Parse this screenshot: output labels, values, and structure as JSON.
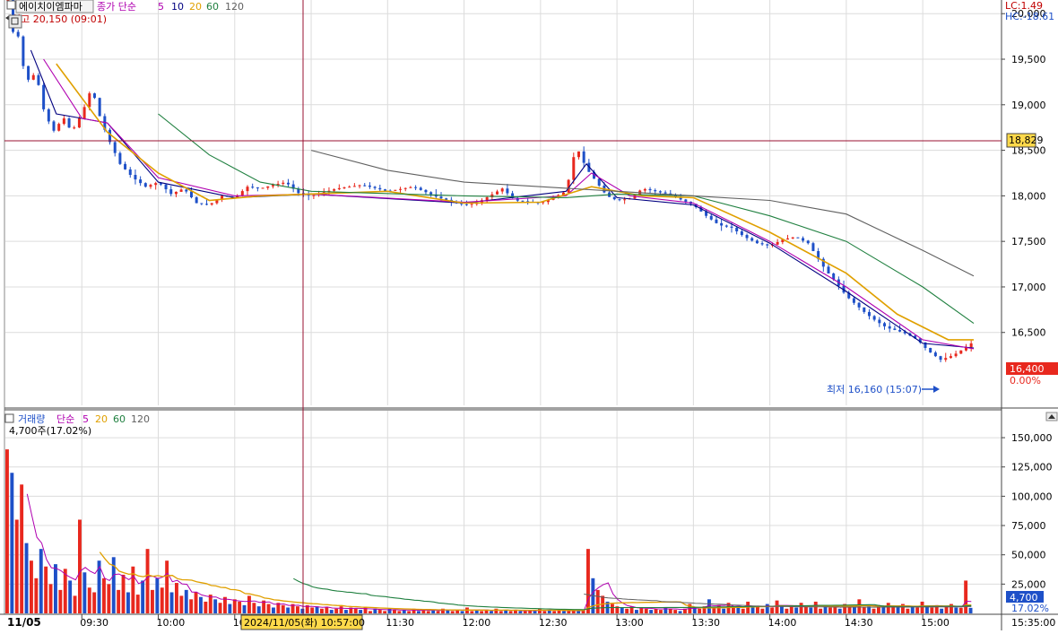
{
  "price_header": {
    "stock_name": "에이치이엠파마",
    "ma_label": "종가 단순",
    "ma_periods": [
      "5",
      "10",
      "20",
      "60",
      "120"
    ],
    "high_label": "최고 20,150 (09:01)",
    "lc": "LC:1.49",
    "hc": "HC:-18.61"
  },
  "volume_header": {
    "label": "거래량",
    "ma_label": "단순",
    "ma_periods": [
      "5",
      "20",
      "60",
      "120"
    ],
    "current": "4,700주(17.02%)"
  },
  "crosshair": {
    "price_value": "18,829",
    "time_label": "2024/11/05(화) 10:57:00"
  },
  "current_price": {
    "value": "16,400",
    "change": "0.00%"
  },
  "current_volume": {
    "value": "4,700",
    "pct": "17.02%"
  },
  "low_label": "최저 16,160 (15:07)",
  "date_label": "11/05",
  "end_time_label": "15:35:00",
  "colors": {
    "up": "#e8281e",
    "down": "#1e50c8",
    "ma5": "#000080",
    "ma10": "#b000b0",
    "ma20": "#e0a000",
    "ma60": "#208040",
    "ma120": "#606060",
    "grid": "#dcdcdc",
    "axis": "#444444",
    "crosshair": "#9a1030"
  },
  "chart_data": {
    "type": "candlestick",
    "session": "2024-11-05",
    "price_axis": {
      "ylim": [
        15700,
        20150
      ],
      "ticks": [
        16500,
        17000,
        17500,
        18000,
        18500,
        19000,
        19500,
        20000
      ]
    },
    "volume_axis": {
      "ylim": [
        0,
        160000
      ],
      "ticks": [
        25000,
        50000,
        75000,
        100000,
        125000,
        150000
      ]
    },
    "time_ticks": [
      "09:30",
      "10:00",
      "10:30",
      "11:00",
      "11:30",
      "12:00",
      "12:30",
      "13:00",
      "13:30",
      "14:00",
      "14:30",
      "15:00"
    ],
    "price_points": [
      [
        "09:01",
        20150
      ],
      [
        "09:02",
        19700
      ],
      [
        "09:04",
        19900
      ],
      [
        "09:06",
        19600
      ],
      [
        "09:08",
        19250
      ],
      [
        "09:12",
        19350
      ],
      [
        "09:15",
        18950
      ],
      [
        "09:18",
        18750
      ],
      [
        "09:20",
        18680
      ],
      [
        "09:22",
        18900
      ],
      [
        "09:26",
        18700
      ],
      [
        "09:30",
        18900
      ],
      [
        "09:34",
        19200
      ],
      [
        "09:36",
        18950
      ],
      [
        "09:40",
        18650
      ],
      [
        "09:45",
        18350
      ],
      [
        "09:50",
        18200
      ],
      [
        "09:55",
        18100
      ],
      [
        "10:00",
        18150
      ],
      [
        "10:05",
        18020
      ],
      [
        "10:10",
        18080
      ],
      [
        "10:15",
        17920
      ],
      [
        "10:20",
        17900
      ],
      [
        "10:25",
        18000
      ],
      [
        "10:30",
        17980
      ],
      [
        "10:35",
        18100
      ],
      [
        "10:40",
        18080
      ],
      [
        "10:45",
        18120
      ],
      [
        "10:50",
        18150
      ],
      [
        "10:55",
        18030
      ],
      [
        "11:00",
        18000
      ],
      [
        "11:10",
        18080
      ],
      [
        "11:20",
        18120
      ],
      [
        "11:30",
        18050
      ],
      [
        "11:40",
        18100
      ],
      [
        "11:50",
        17980
      ],
      [
        "12:00",
        17900
      ],
      [
        "12:05",
        17920
      ],
      [
        "12:10",
        18000
      ],
      [
        "12:15",
        18080
      ],
      [
        "12:20",
        17950
      ],
      [
        "12:30",
        17920
      ],
      [
        "12:35",
        17980
      ],
      [
        "12:40",
        18050
      ],
      [
        "12:44",
        18550
      ],
      [
        "12:48",
        18300
      ],
      [
        "12:52",
        18150
      ],
      [
        "12:56",
        18000
      ],
      [
        "13:00",
        17950
      ],
      [
        "13:05",
        17970
      ],
      [
        "13:10",
        18080
      ],
      [
        "13:20",
        18020
      ],
      [
        "13:30",
        17900
      ],
      [
        "13:35",
        17780
      ],
      [
        "13:40",
        17680
      ],
      [
        "13:45",
        17650
      ],
      [
        "13:50",
        17550
      ],
      [
        "13:55",
        17480
      ],
      [
        "14:00",
        17450
      ],
      [
        "14:05",
        17520
      ],
      [
        "14:10",
        17550
      ],
      [
        "14:15",
        17480
      ],
      [
        "14:18",
        17350
      ],
      [
        "14:22",
        17180
      ],
      [
        "14:26",
        17050
      ],
      [
        "14:30",
        16900
      ],
      [
        "14:34",
        16800
      ],
      [
        "14:38",
        16700
      ],
      [
        "14:42",
        16620
      ],
      [
        "14:46",
        16550
      ],
      [
        "14:50",
        16520
      ],
      [
        "14:54",
        16480
      ],
      [
        "14:58",
        16420
      ],
      [
        "15:02",
        16300
      ],
      [
        "15:07",
        16200
      ],
      [
        "15:12",
        16250
      ],
      [
        "15:16",
        16320
      ],
      [
        "15:20",
        16400
      ]
    ],
    "moving_averages": [
      {
        "name": "5",
        "points": [
          [
            "09:10",
            19600
          ],
          [
            "09:20",
            18900
          ],
          [
            "09:30",
            18850
          ],
          [
            "09:40",
            18800
          ],
          [
            "10:00",
            18150
          ],
          [
            "10:30",
            17980
          ],
          [
            "11:00",
            18020
          ],
          [
            "12:00",
            17920
          ],
          [
            "12:40",
            18050
          ],
          [
            "12:48",
            18350
          ],
          [
            "13:00",
            17980
          ],
          [
            "13:30",
            17900
          ],
          [
            "14:00",
            17480
          ],
          [
            "14:30",
            16950
          ],
          [
            "15:00",
            16380
          ],
          [
            "15:20",
            16330
          ]
        ]
      },
      {
        "name": "10",
        "points": [
          [
            "09:15",
            19500
          ],
          [
            "09:30",
            18850
          ],
          [
            "09:40",
            18800
          ],
          [
            "10:00",
            18200
          ],
          [
            "10:30",
            18000
          ],
          [
            "11:00",
            18020
          ],
          [
            "12:00",
            17930
          ],
          [
            "12:40",
            18000
          ],
          [
            "12:50",
            18250
          ],
          [
            "13:05",
            18000
          ],
          [
            "13:30",
            17920
          ],
          [
            "14:00",
            17500
          ],
          [
            "14:30",
            17000
          ],
          [
            "15:00",
            16420
          ],
          [
            "15:20",
            16320
          ]
        ]
      },
      {
        "name": "20",
        "points": [
          [
            "09:20",
            19450
          ],
          [
            "09:40",
            18700
          ],
          [
            "10:00",
            18250
          ],
          [
            "10:20",
            17950
          ],
          [
            "10:40",
            18000
          ],
          [
            "11:30",
            18050
          ],
          [
            "12:00",
            17920
          ],
          [
            "12:30",
            17930
          ],
          [
            "12:50",
            18100
          ],
          [
            "13:10",
            18000
          ],
          [
            "13:30",
            17980
          ],
          [
            "14:00",
            17600
          ],
          [
            "14:30",
            17150
          ],
          [
            "14:50",
            16700
          ],
          [
            "15:10",
            16420
          ],
          [
            "15:20",
            16420
          ]
        ]
      },
      {
        "name": "60",
        "points": [
          [
            "10:00",
            18900
          ],
          [
            "10:20",
            18450
          ],
          [
            "10:40",
            18150
          ],
          [
            "11:00",
            18050
          ],
          [
            "12:00",
            18000
          ],
          [
            "12:40",
            17980
          ],
          [
            "13:00",
            18020
          ],
          [
            "13:30",
            18000
          ],
          [
            "14:00",
            17780
          ],
          [
            "14:30",
            17500
          ],
          [
            "15:00",
            17000
          ],
          [
            "15:20",
            16600
          ]
        ]
      },
      {
        "name": "120",
        "points": [
          [
            "11:00",
            18500
          ],
          [
            "11:30",
            18280
          ],
          [
            "12:00",
            18150
          ],
          [
            "13:00",
            18050
          ],
          [
            "13:30",
            18000
          ],
          [
            "14:00",
            17950
          ],
          [
            "14:30",
            17800
          ],
          [
            "15:00",
            17400
          ],
          [
            "15:20",
            17120
          ]
        ]
      }
    ],
    "volume_series": [
      [
        140000,
        120000,
        80000,
        110000,
        60000,
        45000,
        30000,
        55000,
        40000,
        25000,
        42000,
        20000,
        38000,
        28000,
        15000,
        80000,
        35000,
        22000,
        18000,
        45000,
        30000,
        25000,
        48000,
        20000,
        33000,
        18000,
        40000,
        16000,
        28000,
        55000,
        20000,
        30000,
        22000,
        45000,
        18000,
        26000,
        15000,
        20000,
        12000,
        18000,
        14000,
        10000,
        16000,
        12000,
        9000,
        14000,
        8000,
        12000,
        10000,
        7000,
        15000,
        9000,
        6000,
        11000,
        8000,
        5000,
        9000,
        7000,
        5000,
        8000,
        6000,
        4000,
        7000,
        5000,
        6000,
        4000,
        5000,
        3000,
        4000,
        6000,
        3000,
        5000,
        4000,
        3000,
        5000,
        2000,
        4000,
        3000,
        2000,
        4000,
        3000,
        2000,
        3000,
        2000,
        4000,
        2000,
        3000,
        2000,
        3000,
        2000,
        4000,
        3000,
        2000,
        3000,
        2000,
        5000,
        2000,
        3000,
        2000,
        3000,
        2000,
        4000,
        2000,
        3000,
        2000,
        3000,
        2000,
        2000,
        3000,
        2000,
        4000,
        2000,
        3000,
        2000,
        3000,
        2000,
        2000,
        3000,
        2000,
        3000,
        55000,
        30000,
        20000,
        15000,
        10000,
        8000,
        6000,
        5000,
        4000,
        6000,
        3000,
        5000,
        4000,
        3000,
        4000,
        3000,
        5000,
        4000,
        3000,
        2000,
        4000,
        8000,
        5000,
        4000,
        6000,
        12000,
        5000,
        7000,
        4000,
        9000,
        5000,
        6000,
        4000,
        10000,
        5000,
        6000,
        4000,
        8000,
        5000,
        11000,
        6000,
        4000,
        7000,
        5000,
        9000,
        6000,
        5000,
        10000,
        4000,
        6000,
        5000,
        7000,
        4000,
        8000,
        6000,
        5000,
        12000,
        5000,
        6000,
        4000,
        7000,
        5000,
        9000,
        6000,
        5000,
        8000,
        4000,
        6000,
        5000,
        10000,
        6000,
        5000,
        7000,
        4000,
        6000,
        8000,
        5000,
        4700,
        28000,
        4700
      ]
    ]
  }
}
